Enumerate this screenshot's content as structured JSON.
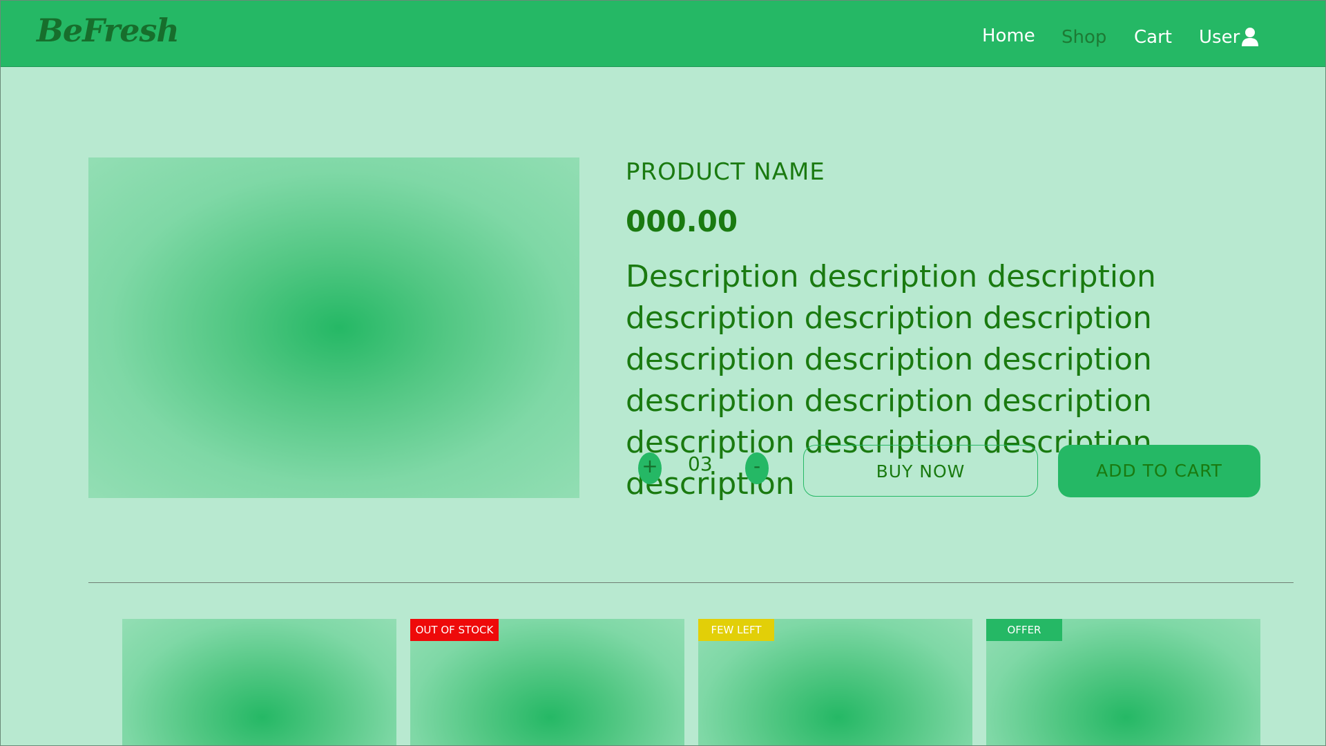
{
  "header": {
    "logo": "BeFresh",
    "nav": {
      "home": "Home",
      "shop": "Shop",
      "cart": "Cart",
      "user": "User"
    },
    "icons": {
      "user": "user-icon"
    }
  },
  "product": {
    "name": "PRODUCT NAME",
    "price": "000.00",
    "description": "Description description description description description description description description description description description description description description description description",
    "quantity": {
      "plus": "+",
      "value": "03",
      "minus": "-"
    },
    "buy_now": "BUY NOW",
    "add_to_cart": "ADD TO CART"
  },
  "related": {
    "cards": [
      {
        "badge": ""
      },
      {
        "badge": "OUT OF STOCK"
      },
      {
        "badge": "FEW LEFT"
      },
      {
        "badge": "OFFER"
      }
    ]
  },
  "colors": {
    "background": "#b8e9d0",
    "navbar": "#25b865",
    "accent": "#25b865",
    "text": "#1a7a10",
    "badge_out_of_stock": "#ee0a0a",
    "badge_few_left": "#e2cf08",
    "badge_offer": "#25b865"
  }
}
